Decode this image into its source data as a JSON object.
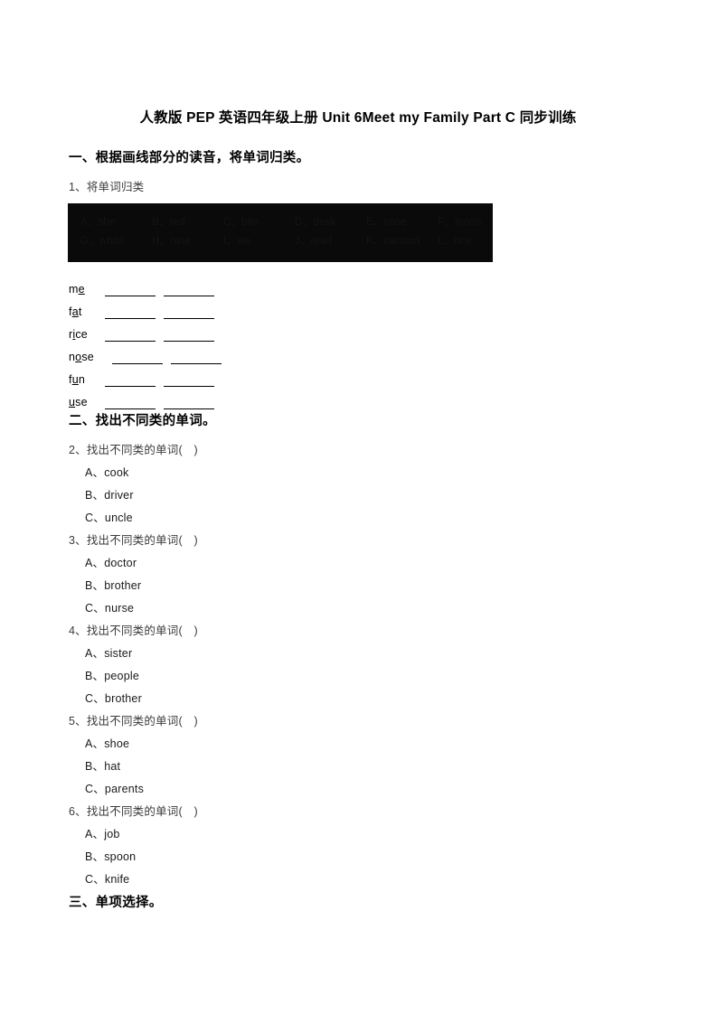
{
  "document": {
    "title": "人教版 PEP 英语四年级上册 Unit 6Meet my Family Part C 同步训练"
  },
  "sections": [
    {
      "heading": "一、根据画线部分的读音，将单词归类。",
      "question_number": "1、将单词归类",
      "word_bank": {
        "row1": [
          "A、she",
          "B、red",
          "C、bite",
          "D、desk",
          "E、nose",
          "F、moon"
        ],
        "row2": [
          "G、white",
          "H、nine",
          "I、we",
          "J、read",
          "K、cartoon",
          "L、rice"
        ]
      },
      "classify_items": [
        {
          "before": "m",
          "underlined": "e",
          "after": ""
        },
        {
          "before": "f",
          "underlined": "a",
          "after": "t"
        },
        {
          "before": "r",
          "underlined": "i",
          "after": "ce"
        },
        {
          "before": "n",
          "underlined": "o",
          "after": "se"
        },
        {
          "before": "f",
          "underlined": "u",
          "after": "n"
        },
        {
          "before": "",
          "underlined": "u",
          "after": "se"
        }
      ]
    },
    {
      "heading": "二、找出不同类的单词。",
      "questions": [
        {
          "stem": "2、找出不同类的单词(　)",
          "options": [
            "A、cook",
            "B、driver",
            "C、uncle"
          ]
        },
        {
          "stem": "3、找出不同类的单词(　)",
          "options": [
            "A、doctor",
            "B、brother",
            "C、nurse"
          ]
        },
        {
          "stem": "4、找出不同类的单词(　)",
          "options": [
            "A、sister",
            "B、people",
            "C、brother"
          ]
        },
        {
          "stem": "5、找出不同类的单词(　)",
          "options": [
            "A、shoe",
            "B、hat",
            "C、parents"
          ]
        },
        {
          "stem": "6、找出不同类的单词(　)",
          "options": [
            "A、job",
            "B、spoon",
            "C、knife"
          ]
        }
      ]
    },
    {
      "heading": "三、单项选择。"
    }
  ]
}
